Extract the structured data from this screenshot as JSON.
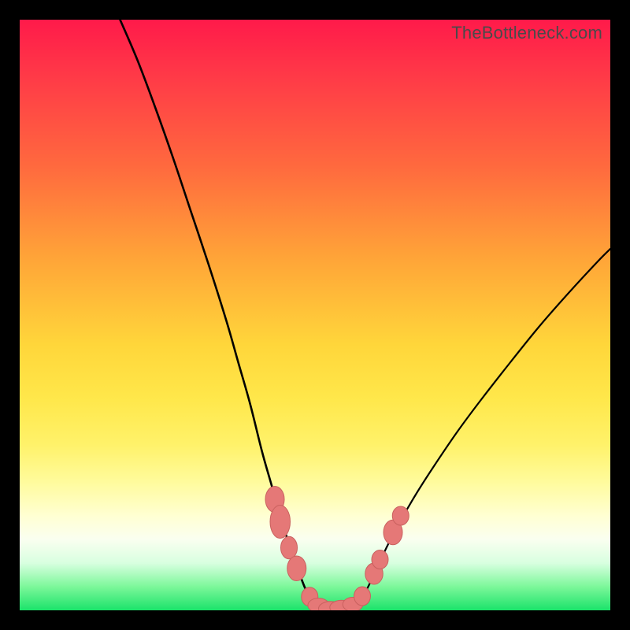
{
  "watermark": "TheBottleneck.com",
  "chart_data": {
    "type": "line",
    "title": "",
    "xlabel": "",
    "ylabel": "",
    "xlim": [
      0,
      100
    ],
    "ylim": [
      0,
      100
    ],
    "grid": false,
    "legend": false,
    "series": [
      {
        "name": "left-curve",
        "x": [
          17,
          20,
          23,
          26,
          29,
          32,
          35,
          37,
          39,
          41,
          42.5,
          44,
          45.5,
          47,
          48.3,
          49.5
        ],
        "y": [
          100,
          93,
          85,
          76.5,
          67.5,
          58.5,
          49,
          42,
          35,
          27,
          21.7,
          16.5,
          11.5,
          7.2,
          3.8,
          1.3
        ]
      },
      {
        "name": "right-curve",
        "x": [
          57.5,
          58.8,
          60.2,
          62,
          64,
          67,
          70,
          74,
          78,
          83,
          88,
          93,
          98,
          100
        ],
        "y": [
          1.3,
          3.6,
          6.5,
          10.4,
          14.3,
          19.5,
          24.2,
          30.1,
          35.5,
          41.9,
          48.1,
          53.8,
          59.2,
          61.2
        ]
      },
      {
        "name": "trough",
        "x": [
          49.5,
          51,
          52.5,
          54,
          55.5,
          57.5
        ],
        "y": [
          1.3,
          0.45,
          0.15,
          0.15,
          0.45,
          1.3
        ]
      }
    ],
    "markers": [
      {
        "x": 43.2,
        "y": 18.8,
        "rx": 1.6,
        "ry": 2.2
      },
      {
        "x": 44.1,
        "y": 15.0,
        "rx": 1.7,
        "ry": 2.8
      },
      {
        "x": 45.6,
        "y": 10.6,
        "rx": 1.4,
        "ry": 1.9
      },
      {
        "x": 46.9,
        "y": 7.1,
        "rx": 1.6,
        "ry": 2.1
      },
      {
        "x": 49.1,
        "y": 2.3,
        "rx": 1.4,
        "ry": 1.6
      },
      {
        "x": 50.6,
        "y": 0.85,
        "rx": 1.8,
        "ry": 1.2
      },
      {
        "x": 52.6,
        "y": 0.3,
        "rx": 2.0,
        "ry": 1.2
      },
      {
        "x": 54.5,
        "y": 0.5,
        "rx": 2.0,
        "ry": 1.2
      },
      {
        "x": 56.4,
        "y": 1.0,
        "rx": 1.7,
        "ry": 1.2
      },
      {
        "x": 58.0,
        "y": 2.4,
        "rx": 1.4,
        "ry": 1.6
      },
      {
        "x": 60.0,
        "y": 6.2,
        "rx": 1.5,
        "ry": 1.8
      },
      {
        "x": 61.0,
        "y": 8.6,
        "rx": 1.4,
        "ry": 1.6
      },
      {
        "x": 63.2,
        "y": 13.2,
        "rx": 1.6,
        "ry": 2.1
      },
      {
        "x": 64.5,
        "y": 16.0,
        "rx": 1.4,
        "ry": 1.6
      }
    ]
  }
}
